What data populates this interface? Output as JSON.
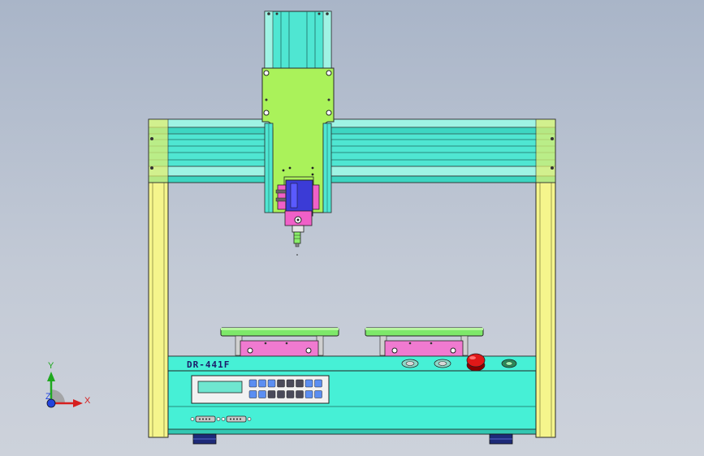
{
  "model_label": "DR-441F",
  "axes": {
    "y_label": "Y",
    "x_label": "X",
    "z_label": "Z"
  },
  "colors": {
    "frame_yellow": "#f5f58c",
    "beam_cyan": "#4fe6d2",
    "carriage_green": "#aaf25a",
    "head_magenta": "#f060c8",
    "head_blue": "#3b3bd6",
    "platform_green": "#7ee86a",
    "fixture_pink": "#f07ad0",
    "base_cyan": "#46f0d6",
    "key_blue": "#5b8ef2",
    "key_dark": "#4a4a5a",
    "estop_red": "#e01818",
    "foot_navy": "#1d2a78"
  },
  "keypad": {
    "rows": 2,
    "cols": 8
  }
}
